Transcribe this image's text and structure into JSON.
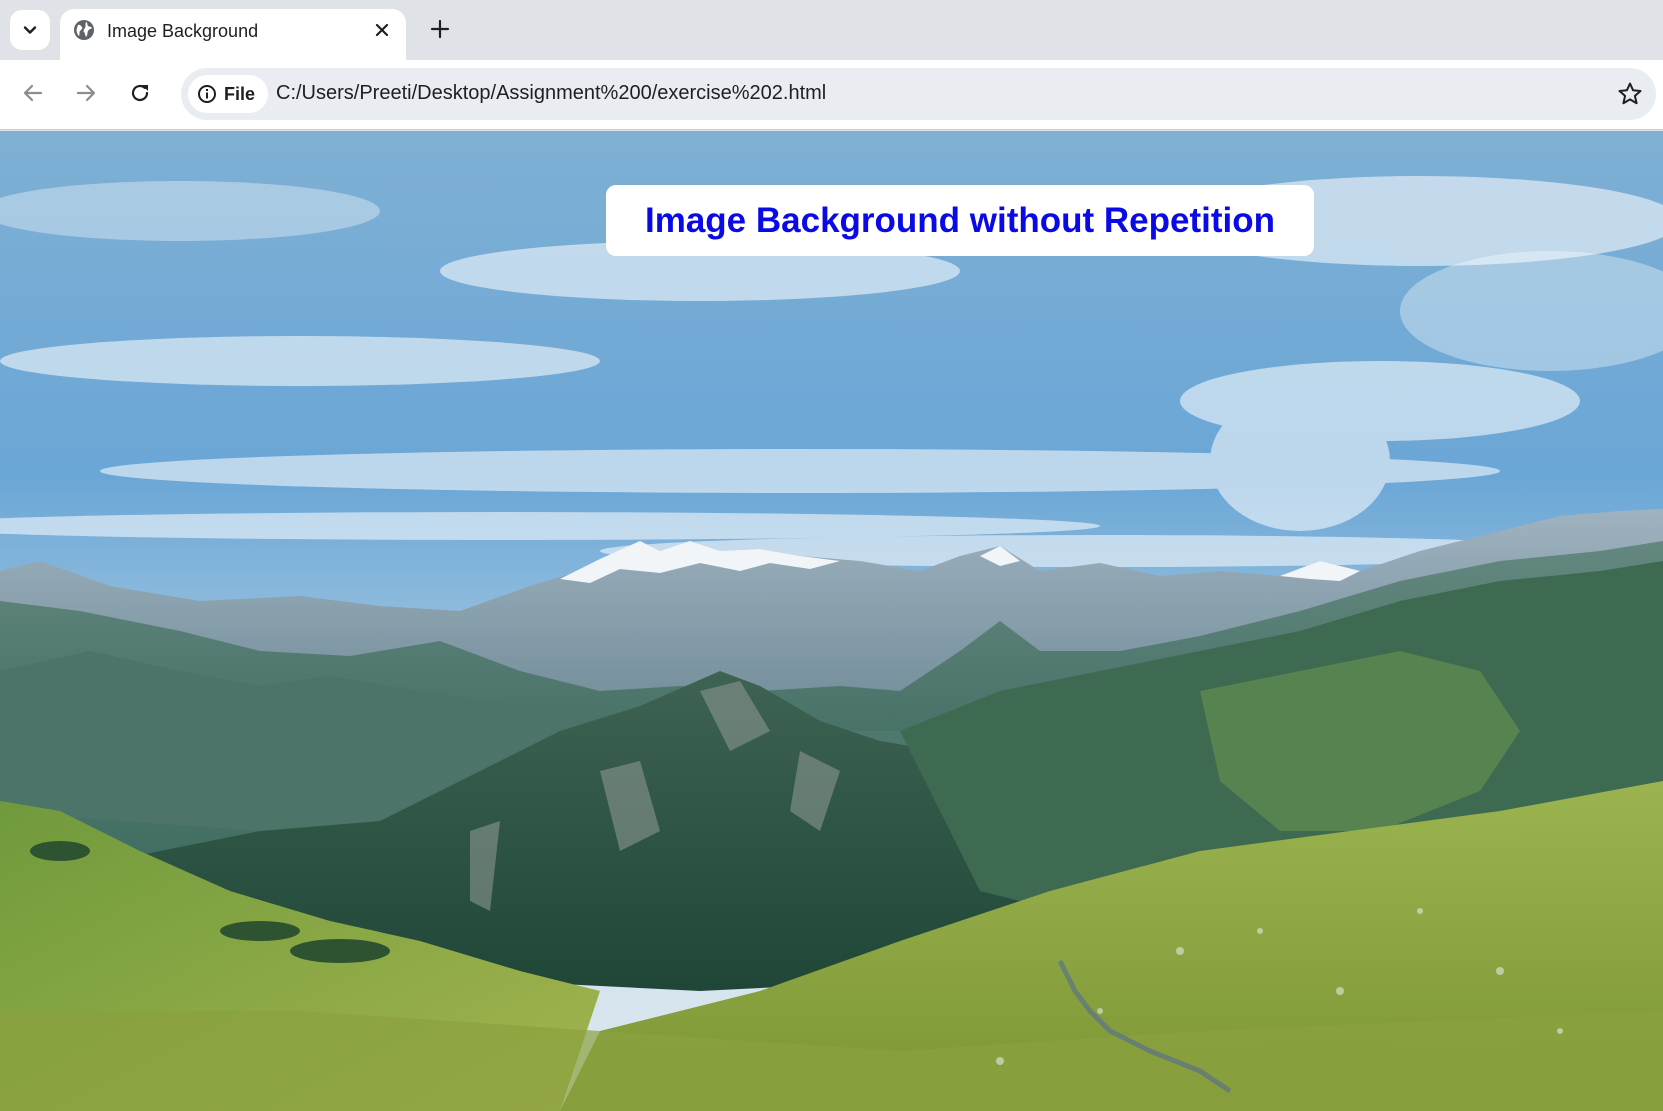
{
  "browser": {
    "tab": {
      "title": "Image Background",
      "favicon_icon": "globe-icon",
      "close_icon": "close-icon"
    },
    "tab_search_icon": "chevron-down-icon",
    "new_tab_icon": "plus-icon",
    "toolbar": {
      "back_icon": "arrow-left-icon",
      "forward_icon": "arrow-right-icon",
      "reload_icon": "reload-icon",
      "site_info": {
        "icon": "info-icon",
        "label": "File"
      },
      "url": "C:/Users/Preeti/Desktop/Assignment%200/exercise%202.html",
      "bookmark_icon": "star-outline-icon"
    }
  },
  "page": {
    "heading": "Image Background without Repetition",
    "heading_color": "#0a0ae6",
    "background_image": "mountain-landscape"
  }
}
